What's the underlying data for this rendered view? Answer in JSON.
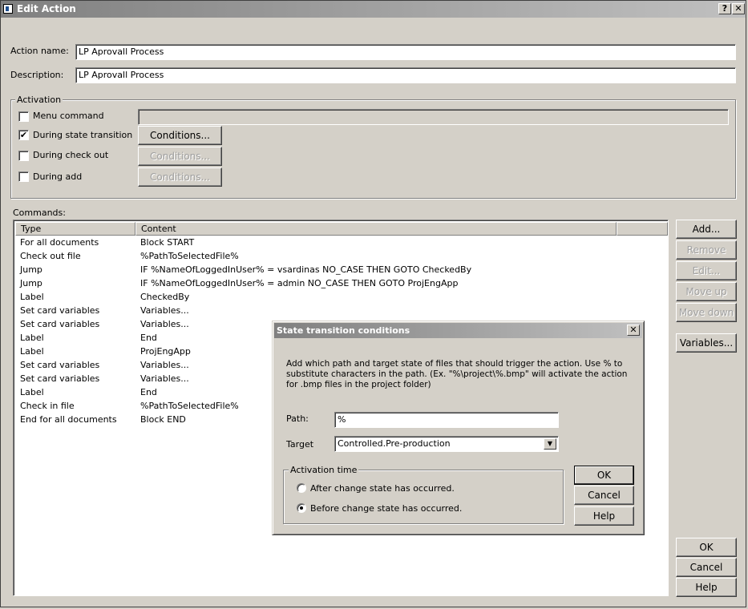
{
  "window": {
    "title": "Edit Action",
    "help_btn": "?",
    "close_btn": "✕"
  },
  "form": {
    "action_name_label": "Action name:",
    "action_name_value": "LP Aprovall Process",
    "description_label": "Description:",
    "description_value": "LP Aprovall Process"
  },
  "activation": {
    "title": "Activation",
    "menu_command": {
      "label": "Menu command",
      "checked": false,
      "value": ""
    },
    "state_transition": {
      "label": "During state transition",
      "checked": true,
      "button": "Conditions..."
    },
    "check_out": {
      "label": "During check out",
      "checked": false,
      "button": "Conditions..."
    },
    "add": {
      "label": "During add",
      "checked": false,
      "button": "Conditions..."
    }
  },
  "commands": {
    "label": "Commands:",
    "columns": [
      "Type",
      "Content"
    ],
    "rows": [
      {
        "type": "For all documents",
        "content": "Block START"
      },
      {
        "type": "Check out file",
        "content": "%PathToSelectedFile%"
      },
      {
        "type": "Jump",
        "content": "IF %NameOfLoggedInUser% = vsardinas NO_CASE THEN GOTO CheckedBy"
      },
      {
        "type": "Jump",
        "content": "IF %NameOfLoggedInUser% = admin NO_CASE THEN GOTO ProjEngApp"
      },
      {
        "type": "Label",
        "content": "CheckedBy"
      },
      {
        "type": "Set card variables",
        "content": "Variables..."
      },
      {
        "type": "Set card variables",
        "content": "Variables..."
      },
      {
        "type": "Label",
        "content": "End"
      },
      {
        "type": "Label",
        "content": "ProjEngApp"
      },
      {
        "type": "Set card variables",
        "content": "Variables..."
      },
      {
        "type": "Set card variables",
        "content": "Variables..."
      },
      {
        "type": "Label",
        "content": "End"
      },
      {
        "type": "Check in file",
        "content": "%PathToSelectedFile%"
      },
      {
        "type": "End for all documents",
        "content": "Block END"
      }
    ]
  },
  "side_buttons": {
    "add": "Add...",
    "remove": "Remove",
    "edit": "Edit...",
    "move_up": "Move up",
    "move_down": "Move down",
    "variables": "Variables..."
  },
  "bottom_buttons": {
    "ok": "OK",
    "cancel": "Cancel",
    "help": "Help"
  },
  "dialog": {
    "title": "State transition conditions",
    "close_btn": "✕",
    "description": "Add which path and target state of files that should trigger the action. Use % to substitute characters in the path. (Ex. \"%\\project\\%.bmp\" will activate the action for .bmp files in the project folder)",
    "path_label": "Path:",
    "path_value": "%",
    "target_label": "Target",
    "target_value": "Controlled.Pre-production",
    "activation_time_title": "Activation time",
    "after_label": "After change state has occurred.",
    "before_label": "Before change state has occurred.",
    "selected": "before",
    "ok": "OK",
    "cancel": "Cancel",
    "help": "Help"
  }
}
